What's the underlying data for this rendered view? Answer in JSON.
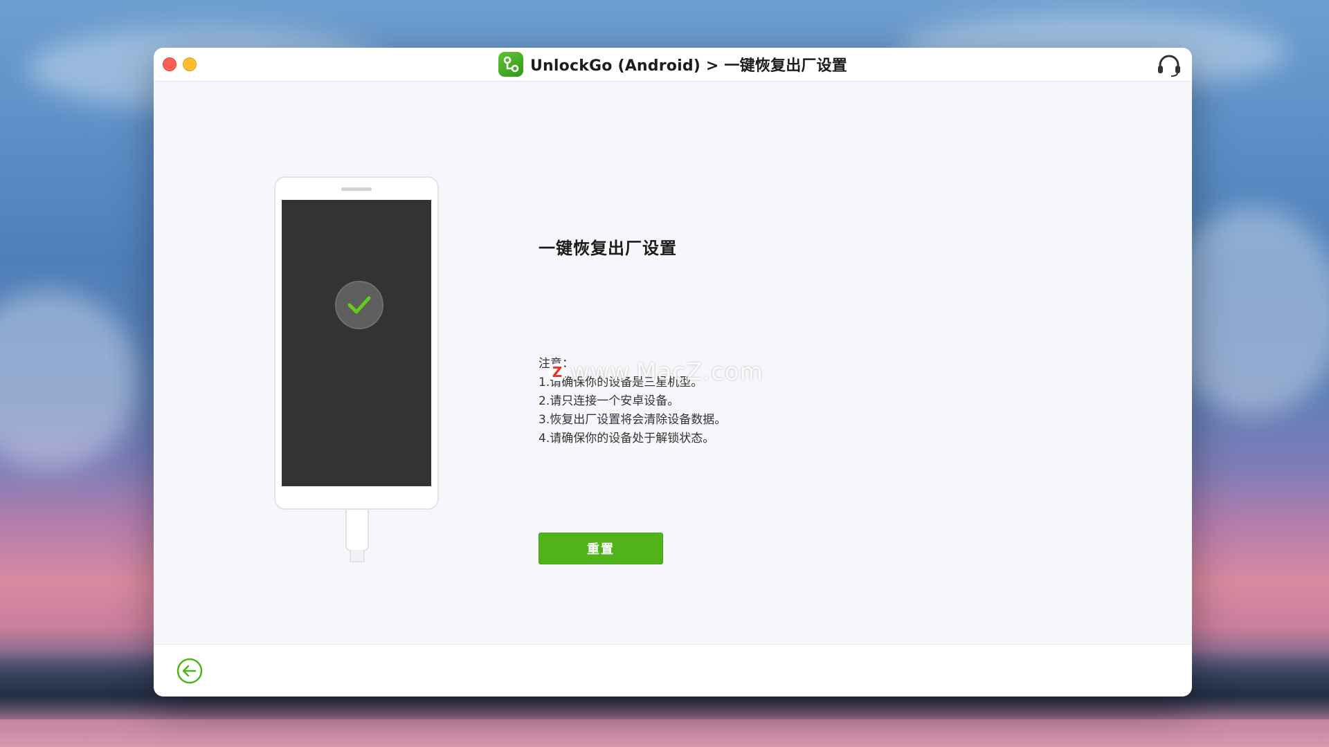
{
  "window": {
    "title": "UnlockGo (Android) > 一键恢复出厂设置"
  },
  "main": {
    "heading": "一键恢复出厂设置",
    "notes": [
      "注意：",
      "1.请确保你的设备是三星机型。",
      "2.请只连接一个安卓设备。",
      "3.恢复出厂设置将会清除设备数据。",
      "4.请确保你的设备处于解锁状态。"
    ],
    "reset_label": "重置"
  },
  "watermark": {
    "logo_letter": "Z",
    "text": "www.MacZ.com"
  },
  "icons": {
    "app": "unlockgo-logo-icon",
    "support": "headset-icon",
    "status": "checkmark-icon",
    "back": "back-arrow-icon"
  },
  "colors": {
    "accent": "#4fb319",
    "close": "#fe5f57",
    "minimize": "#febc2e",
    "phone_screen": "#333333"
  }
}
